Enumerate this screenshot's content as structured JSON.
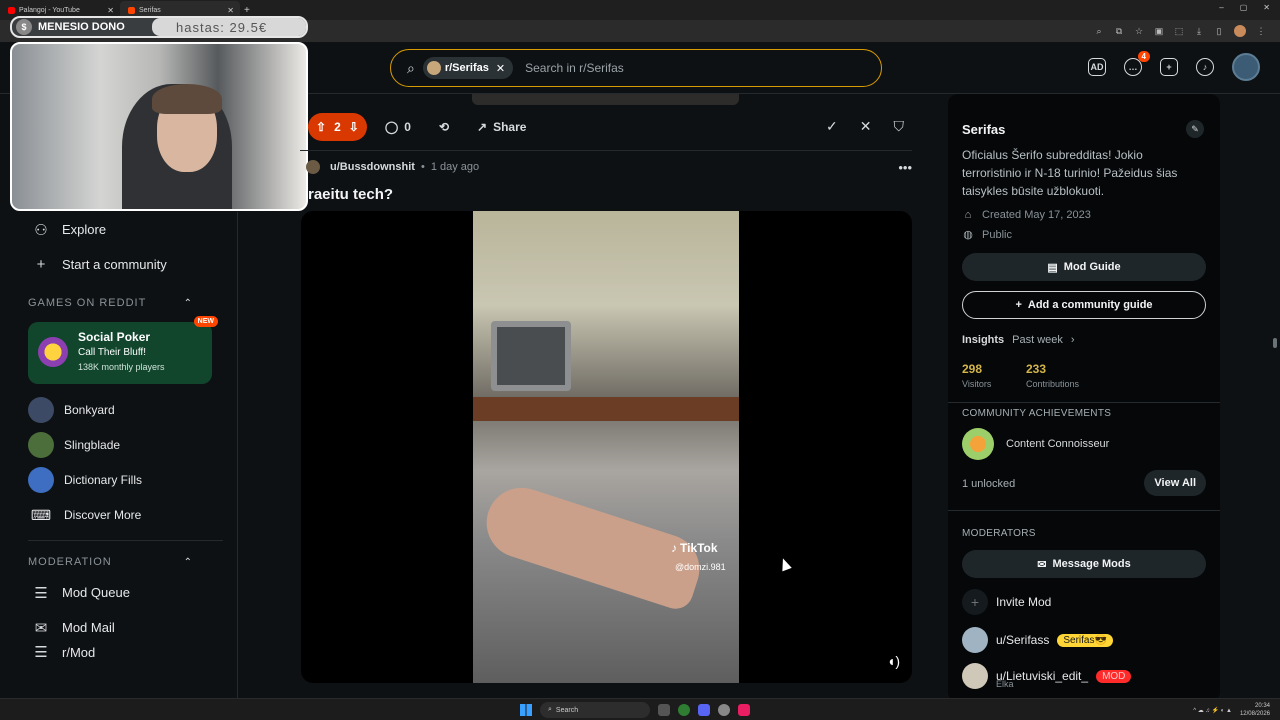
{
  "browser": {
    "tabs": [
      {
        "title": "Palangoj - YouTube",
        "favicon_color": "#ff0000"
      },
      {
        "title": "Serifas",
        "favicon_color": "#ff4500"
      }
    ],
    "new_tab": "+",
    "window_controls": [
      "–",
      "▢",
      "✕"
    ]
  },
  "overlay": {
    "dono_label": "MENESIO DONO",
    "dono_goal": "hastas: 29.5€"
  },
  "search": {
    "subreddit_chip": "r/Serifas",
    "placeholder": "Search in r/Serifas"
  },
  "header": {
    "notification_count": "4"
  },
  "sidebar": {
    "nav": [
      {
        "label": "Explore",
        "icon": "explore-icon"
      },
      {
        "label": "Start a community",
        "icon": "plus-icon"
      }
    ],
    "games_section": "GAMES ON REDDIT",
    "featured_game": {
      "title": "Social Poker",
      "subtitle": "Call Their Bluff!",
      "players": "138K monthly players",
      "badge": "NEW"
    },
    "games": [
      {
        "label": "Bonkyard",
        "color": "#3d4a66"
      },
      {
        "label": "Slingblade",
        "color": "#4b6e3a"
      },
      {
        "label": "Dictionary Fills",
        "color": "#3d6ec2"
      },
      {
        "label": "Discover More",
        "color": ""
      }
    ],
    "moderation_section": "MODERATION",
    "moderation": [
      {
        "label": "Mod Queue"
      },
      {
        "label": "Mod Mail"
      },
      {
        "label": "r/Mod"
      }
    ]
  },
  "post": {
    "vote_count": "2",
    "comment_count": "0",
    "share_label": "Share",
    "author": "u/Bussdownshit",
    "time": "1 day ago",
    "title": "raeitu tech?",
    "video_watermark": "TikTok",
    "video_user": "@domzi.981"
  },
  "community": {
    "name": "Serifas",
    "description": "Oficialus Šerifo subredditas! Jokio terroristinio ir N-18 turinio! Pažeidus šias taisykles būsite užblokuoti.",
    "created": "Created May 17, 2023",
    "visibility": "Public",
    "mod_guide_label": "Mod Guide",
    "add_guide_label": "Add a community guide",
    "insights_label": "Insights",
    "insights_period": "Past week",
    "visitors": "298",
    "visitors_label": "Visitors",
    "contributions": "233",
    "contributions_label": "Contributions",
    "achievements_heading": "COMMUNITY ACHIEVEMENTS",
    "achievement_name": "Content Connoisseur",
    "unlocked": "1 unlocked",
    "view_all": "View All",
    "moderators_heading": "MODERATORS",
    "message_mods": "Message Mods",
    "invite_mod": "Invite Mod",
    "mods": [
      {
        "name": "u/Serifass",
        "flair": "Serifas😎",
        "flair_color": "#ffd635"
      },
      {
        "name": "u/Lietuviski_edit_",
        "flair": "MOD",
        "flair_color": "#ff2a2a",
        "sub": "Elka"
      }
    ]
  },
  "taskbar": {
    "search_label": "Search",
    "time": "20:34",
    "date": "12/08/2026"
  }
}
